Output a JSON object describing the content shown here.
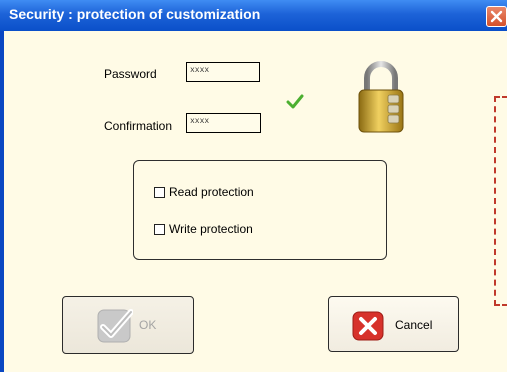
{
  "window": {
    "title": "Security : protection of customization"
  },
  "form": {
    "password_label": "Password",
    "password_value": "xxxx",
    "confirmation_label": "Confirmation",
    "confirmation_value": "xxxx"
  },
  "options": [
    {
      "label": "Read protection",
      "checked": false
    },
    {
      "label": "Write protection",
      "checked": false
    }
  ],
  "buttons": {
    "ok_label": "OK",
    "ok_enabled": false,
    "cancel_label": "Cancel"
  },
  "icons": {
    "close": "close-icon",
    "match": "check-icon",
    "lock": "padlock-icon",
    "ok": "checkmark-icon",
    "cancel": "red-x-icon"
  },
  "colors": {
    "title_bar": "#1d63d8",
    "background": "#fffbe6",
    "dashed_border": "#c0392b",
    "check_green": "#4caf30"
  }
}
